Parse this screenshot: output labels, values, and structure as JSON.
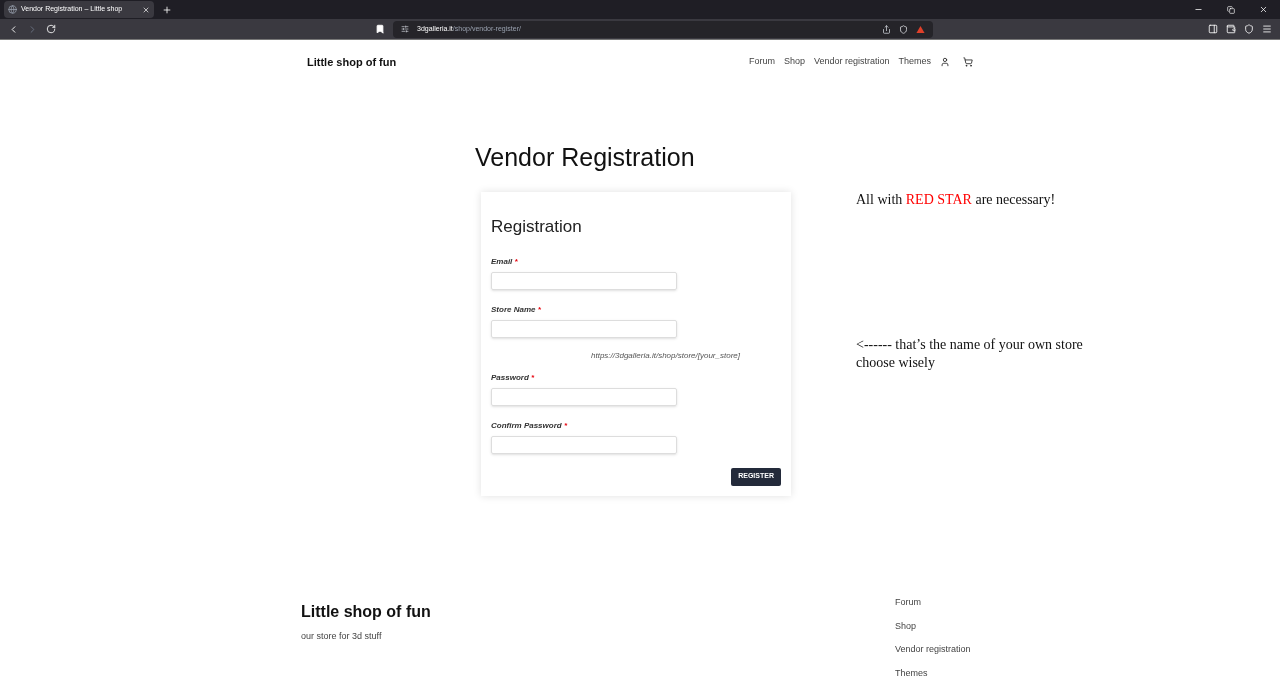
{
  "browser": {
    "tab": {
      "title": "Vendor Registration – Little shop",
      "selected": true
    },
    "url_host": "3dgalleria.it",
    "url_path": "/shop/vendor-register/"
  },
  "header": {
    "brand": "Little shop of fun",
    "nav": [
      "Forum",
      "Shop",
      "Vendor registration",
      "Themes"
    ]
  },
  "page_title": "Vendor Registration",
  "form": {
    "title": "Registration",
    "fields": [
      {
        "label": "Email",
        "required_mark": "*"
      },
      {
        "label": "Store Name",
        "required_mark": "*",
        "hint": "https://3dgalleria.it/shop/store/[your_store]"
      },
      {
        "label": "Password",
        "required_mark": "*"
      },
      {
        "label": "Confirm Password",
        "required_mark": "*"
      }
    ],
    "submit": "REGISTER"
  },
  "notes": {
    "required": {
      "before": "All with",
      "highlight": "RED STAR",
      "after": "are necessary!"
    },
    "store_name": [
      "<------ that’s the name of your own store",
      "choose wisely"
    ]
  },
  "footer": {
    "brand": "Little shop of fun",
    "tagline": "our store for 3d stuff",
    "links": [
      "Forum",
      "Shop",
      "Vendor registration",
      "Themes"
    ]
  }
}
